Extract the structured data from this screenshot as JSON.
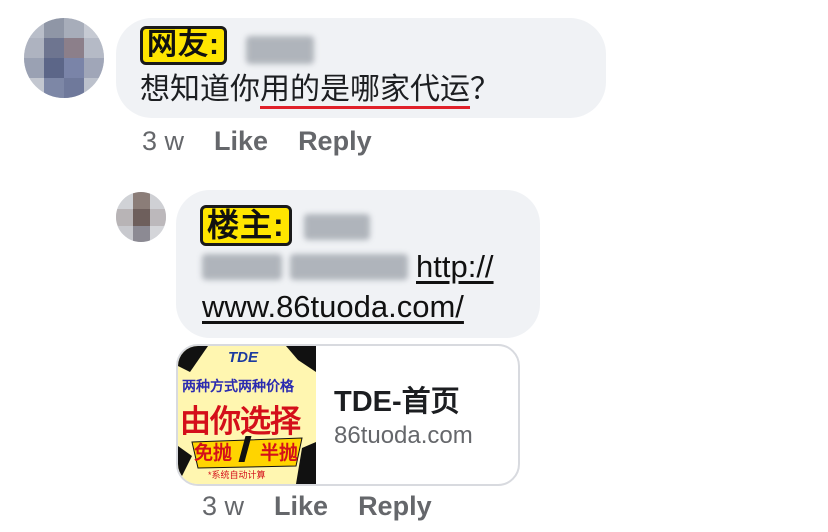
{
  "comment1": {
    "name_tag": "网友:",
    "text_before": "想知道你",
    "text_underlined": "用的是哪家代运",
    "text_after": "？",
    "time": "3 w",
    "like_label": "Like",
    "reply_label": "Reply"
  },
  "comment2": {
    "name_tag": "楼主:",
    "link_line1": "http://",
    "link_line2": "www.86tuoda.com/",
    "time": "3 w",
    "like_label": "Like",
    "reply_label": "Reply"
  },
  "link_preview": {
    "title": "TDE-首页",
    "domain": "86tuoda.com",
    "thumbnail": {
      "brand": "TDE",
      "headline": "两种方式两种价格",
      "big_text": "由你选择",
      "left_badge": "免抛",
      "right_badge": "半抛",
      "footer": "*系统自动计算"
    }
  },
  "colors": {
    "bubble_bg": "#f0f2f5",
    "name_tag_bg": "#ffe500",
    "underline": "#e0202a",
    "meta_text": "#65676b"
  }
}
